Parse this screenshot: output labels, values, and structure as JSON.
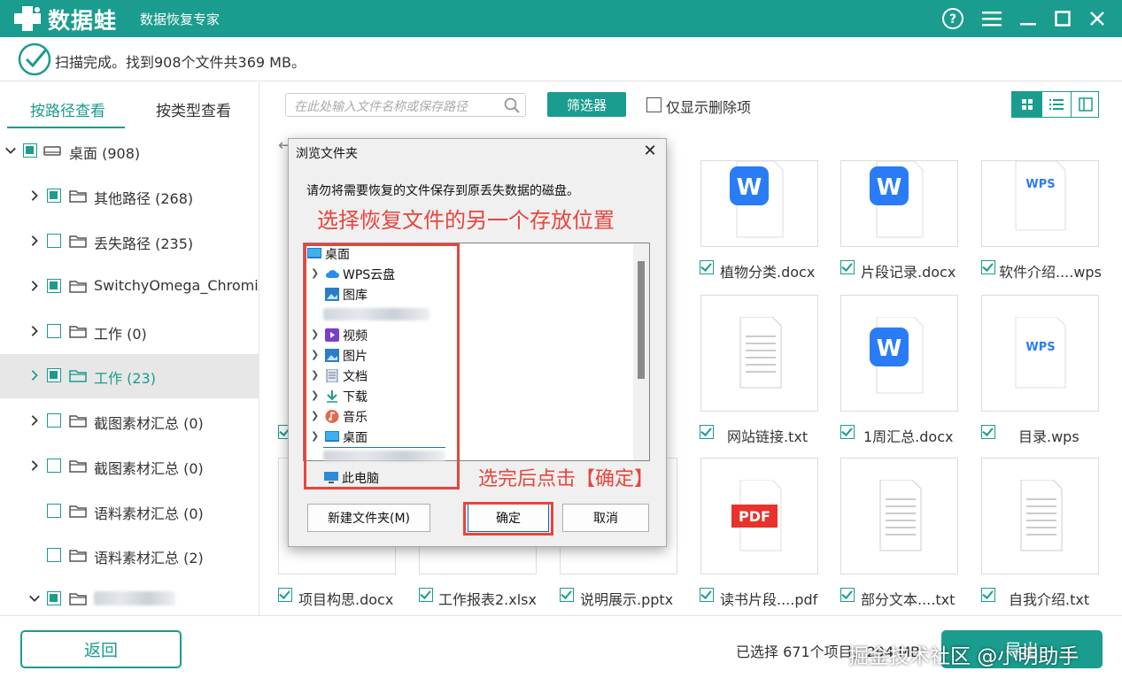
{
  "app": {
    "brand": "数据蛙",
    "subtitle": "数据恢复专家"
  },
  "colors": {
    "accent": "#1a9c8e",
    "annotation": "#e8453c"
  },
  "status": {
    "text": "扫描完成。找到908个文件共369 MB。"
  },
  "left_tabs": {
    "by_path": "按路径查看",
    "by_type": "按类型查看"
  },
  "tree": [
    {
      "label": "桌面 (908)",
      "checked": true,
      "expanded": true
    },
    {
      "label": "其他路径 (268)",
      "checked": true
    },
    {
      "label": "丢失路径 (235)",
      "checked": false
    },
    {
      "label": "SwitchyOmega_Chromium",
      "checked": true
    },
    {
      "label": "工作 (0)",
      "checked": false
    },
    {
      "label": "工作 (23)",
      "checked": true,
      "selected": true
    },
    {
      "label": "截图素材汇总 (0)",
      "checked": false
    },
    {
      "label": "截图素材汇总 (0)",
      "checked": false
    },
    {
      "label": "语料素材汇总 (0)",
      "checked": false
    },
    {
      "label": "语料素材汇总 (2)",
      "checked": false
    }
  ],
  "toolbar": {
    "search_placeholder": "在此处输入文件名称或保存路径",
    "filter_label": "筛选器",
    "only_deleted_label": "仅显示删除项"
  },
  "files": {
    "row1": [
      "植物分类.docx",
      "片段记录.docx",
      "软件介绍....wps"
    ],
    "row2": [
      "网站链接.txt",
      "1周汇总.docx",
      "目录.wps"
    ],
    "row3": [
      "项目构思.docx",
      "工作报表2.xlsx",
      "说明展示.pptx",
      "读书片段....pdf",
      "部分文本....txt",
      "自我介绍.txt"
    ]
  },
  "dialog": {
    "title": "浏览文件夹",
    "message": "请勿将需要恢复的文件保存到原丢失数据的磁盘。",
    "annotation_top": "选择恢复文件的另一个存放位置",
    "annotation_bottom": "选完后点击【确定】",
    "tree": {
      "root": "桌面",
      "items": [
        "WPS云盘",
        "图库",
        "视频",
        "图片",
        "文档",
        "下载",
        "音乐",
        "桌面",
        "此电脑"
      ]
    },
    "new_folder": "新建文件夹(M)",
    "ok": "确定",
    "cancel": "取消"
  },
  "bottom": {
    "back": "返回",
    "selected": "已选择 671个项目，294 MB",
    "export": "导出"
  },
  "watermark": "掘金技术社区 @小明助手"
}
